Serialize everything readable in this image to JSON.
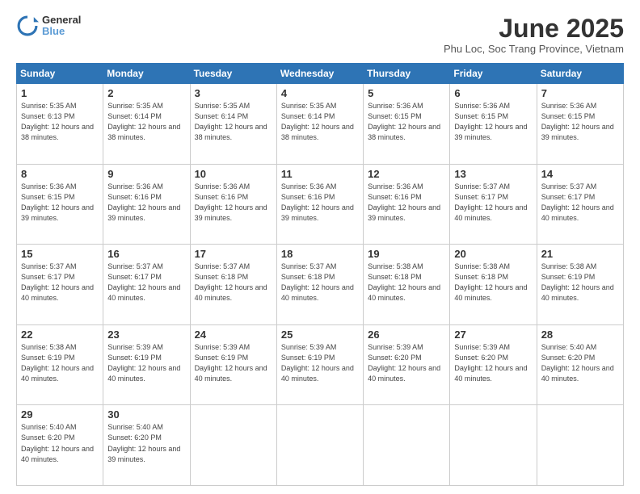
{
  "header": {
    "logo_line1": "General",
    "logo_line2": "Blue",
    "title": "June 2025",
    "subtitle": "Phu Loc, Soc Trang Province, Vietnam"
  },
  "weekdays": [
    "Sunday",
    "Monday",
    "Tuesday",
    "Wednesday",
    "Thursday",
    "Friday",
    "Saturday"
  ],
  "weeks": [
    [
      {
        "day": "1",
        "sunrise": "5:35 AM",
        "sunset": "6:13 PM",
        "daylight": "12 hours and 38 minutes."
      },
      {
        "day": "2",
        "sunrise": "5:35 AM",
        "sunset": "6:14 PM",
        "daylight": "12 hours and 38 minutes."
      },
      {
        "day": "3",
        "sunrise": "5:35 AM",
        "sunset": "6:14 PM",
        "daylight": "12 hours and 38 minutes."
      },
      {
        "day": "4",
        "sunrise": "5:35 AM",
        "sunset": "6:14 PM",
        "daylight": "12 hours and 38 minutes."
      },
      {
        "day": "5",
        "sunrise": "5:36 AM",
        "sunset": "6:15 PM",
        "daylight": "12 hours and 38 minutes."
      },
      {
        "day": "6",
        "sunrise": "5:36 AM",
        "sunset": "6:15 PM",
        "daylight": "12 hours and 39 minutes."
      },
      {
        "day": "7",
        "sunrise": "5:36 AM",
        "sunset": "6:15 PM",
        "daylight": "12 hours and 39 minutes."
      }
    ],
    [
      {
        "day": "8",
        "sunrise": "5:36 AM",
        "sunset": "6:15 PM",
        "daylight": "12 hours and 39 minutes."
      },
      {
        "day": "9",
        "sunrise": "5:36 AM",
        "sunset": "6:16 PM",
        "daylight": "12 hours and 39 minutes."
      },
      {
        "day": "10",
        "sunrise": "5:36 AM",
        "sunset": "6:16 PM",
        "daylight": "12 hours and 39 minutes."
      },
      {
        "day": "11",
        "sunrise": "5:36 AM",
        "sunset": "6:16 PM",
        "daylight": "12 hours and 39 minutes."
      },
      {
        "day": "12",
        "sunrise": "5:36 AM",
        "sunset": "6:16 PM",
        "daylight": "12 hours and 39 minutes."
      },
      {
        "day": "13",
        "sunrise": "5:37 AM",
        "sunset": "6:17 PM",
        "daylight": "12 hours and 40 minutes."
      },
      {
        "day": "14",
        "sunrise": "5:37 AM",
        "sunset": "6:17 PM",
        "daylight": "12 hours and 40 minutes."
      }
    ],
    [
      {
        "day": "15",
        "sunrise": "5:37 AM",
        "sunset": "6:17 PM",
        "daylight": "12 hours and 40 minutes."
      },
      {
        "day": "16",
        "sunrise": "5:37 AM",
        "sunset": "6:17 PM",
        "daylight": "12 hours and 40 minutes."
      },
      {
        "day": "17",
        "sunrise": "5:37 AM",
        "sunset": "6:18 PM",
        "daylight": "12 hours and 40 minutes."
      },
      {
        "day": "18",
        "sunrise": "5:37 AM",
        "sunset": "6:18 PM",
        "daylight": "12 hours and 40 minutes."
      },
      {
        "day": "19",
        "sunrise": "5:38 AM",
        "sunset": "6:18 PM",
        "daylight": "12 hours and 40 minutes."
      },
      {
        "day": "20",
        "sunrise": "5:38 AM",
        "sunset": "6:18 PM",
        "daylight": "12 hours and 40 minutes."
      },
      {
        "day": "21",
        "sunrise": "5:38 AM",
        "sunset": "6:19 PM",
        "daylight": "12 hours and 40 minutes."
      }
    ],
    [
      {
        "day": "22",
        "sunrise": "5:38 AM",
        "sunset": "6:19 PM",
        "daylight": "12 hours and 40 minutes."
      },
      {
        "day": "23",
        "sunrise": "5:39 AM",
        "sunset": "6:19 PM",
        "daylight": "12 hours and 40 minutes."
      },
      {
        "day": "24",
        "sunrise": "5:39 AM",
        "sunset": "6:19 PM",
        "daylight": "12 hours and 40 minutes."
      },
      {
        "day": "25",
        "sunrise": "5:39 AM",
        "sunset": "6:19 PM",
        "daylight": "12 hours and 40 minutes."
      },
      {
        "day": "26",
        "sunrise": "5:39 AM",
        "sunset": "6:20 PM",
        "daylight": "12 hours and 40 minutes."
      },
      {
        "day": "27",
        "sunrise": "5:39 AM",
        "sunset": "6:20 PM",
        "daylight": "12 hours and 40 minutes."
      },
      {
        "day": "28",
        "sunrise": "5:40 AM",
        "sunset": "6:20 PM",
        "daylight": "12 hours and 40 minutes."
      }
    ],
    [
      {
        "day": "29",
        "sunrise": "5:40 AM",
        "sunset": "6:20 PM",
        "daylight": "12 hours and 40 minutes."
      },
      {
        "day": "30",
        "sunrise": "5:40 AM",
        "sunset": "6:20 PM",
        "daylight": "12 hours and 39 minutes."
      },
      null,
      null,
      null,
      null,
      null
    ]
  ],
  "labels": {
    "sunrise": "Sunrise:",
    "sunset": "Sunset:",
    "daylight": "Daylight:"
  }
}
